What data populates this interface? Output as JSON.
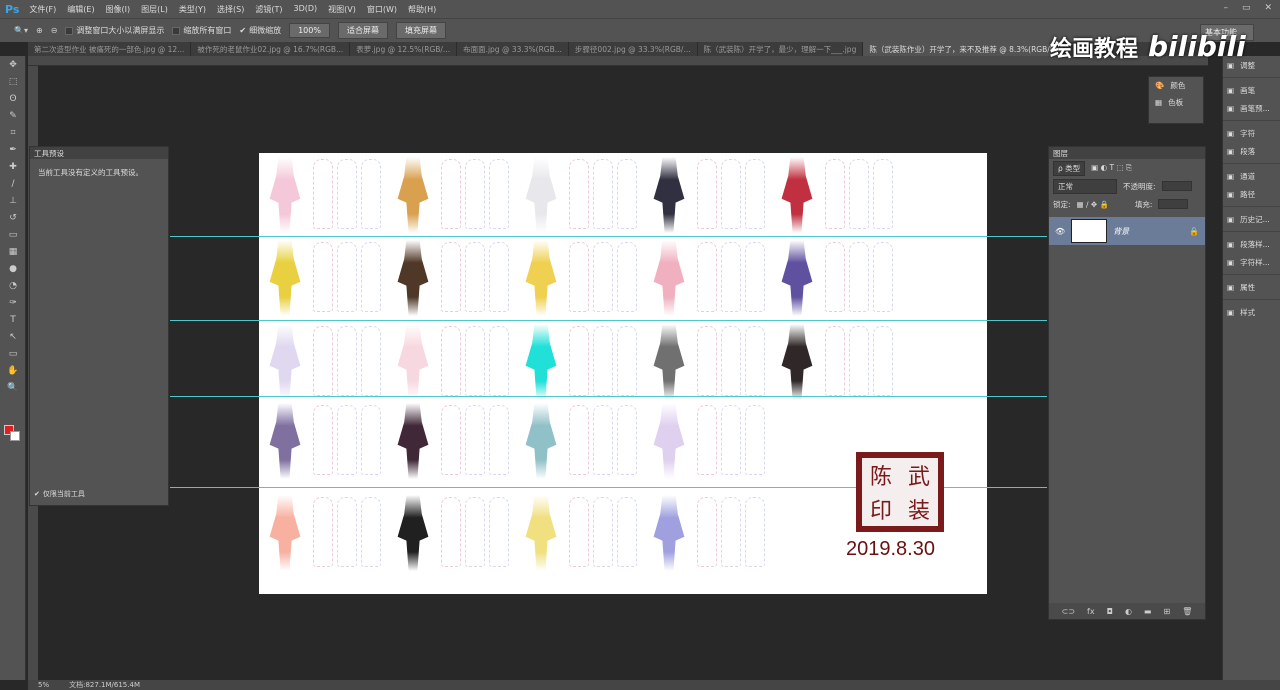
{
  "app": {
    "logo": "Ps"
  },
  "menu": [
    "文件(F)",
    "编辑(E)",
    "图像(I)",
    "图层(L)",
    "类型(Y)",
    "选择(S)",
    "滤镜(T)",
    "3D(D)",
    "视图(V)",
    "窗口(W)",
    "帮助(H)"
  ],
  "window_controls": [
    "–",
    "▭",
    "✕"
  ],
  "options": {
    "resize_windows": "调整窗口大小以满屏显示",
    "zoom_all": "缩放所有窗口",
    "scrubby_zoom": "细微缩放",
    "zoom_pct": "100%",
    "fit_screen": "适合屏幕",
    "fill_screen": "填充屏幕",
    "workspace": "基本功能"
  },
  "tabs": [
    "第二次造型作业 被痛死的一部色.jpg @ 12...",
    "被作死的老鼠作业02.jpg @ 16.7%(RGB...",
    "表萝.jpg @ 12.5%(RGB/...",
    "布面面.jpg @ 33.3%(RGB...",
    "步骤径002.jpg @ 33.3%(RGB/...",
    "陈（武装陈）开学了，最少，理解一下___.jpg",
    "陈（武装陈作业）开学了，来不及推荐 @ 8.3%(RGB/8)"
  ],
  "presets_panel": {
    "title": "工具预设",
    "message": "当前工具没有定义的工具预设。",
    "current_only": "仅限当前工具"
  },
  "canvas": {
    "stamp": [
      "陈",
      "武",
      "印",
      "装"
    ],
    "date": "2019.8.30",
    "thumbs": [
      [
        "#f4c8d8",
        "#d9a050",
        "#e8e8ec",
        "#303040",
        "#c03040"
      ],
      [
        "#e8d040",
        "#503828",
        "#f0d050",
        "#f0b0c0",
        "#6050a0"
      ],
      [
        "#e0d8f0",
        "#f8d8e0",
        "#20e0d8",
        "#707070",
        "#302828"
      ],
      [
        "#8070a0",
        "#402838",
        "#90c0c8",
        "#e0d0f0",
        ""
      ],
      [
        "#f8b0a0",
        "#202020",
        "#f0e080",
        "#a0a0e0",
        ""
      ]
    ]
  },
  "color_panel": {
    "items": [
      "颜色",
      "色板"
    ]
  },
  "layers_panel": {
    "title": "图层",
    "filter": "ρ 类型",
    "blend": "正常",
    "opacity_label": "不透明度:",
    "lock_label": "锁定:",
    "fill_label": "填充:",
    "layer_name": "背景"
  },
  "dock": [
    "调整",
    "画笔",
    "画笔预...",
    "字符",
    "段落",
    "通道",
    "路径",
    "历史记...",
    "段落样...",
    "字符样...",
    "属性",
    "样式"
  ],
  "status": {
    "zoom": "5%",
    "doc": "文档:827.1M/615.4M"
  },
  "watermark": {
    "text": "绘画教程",
    "brand": "bilibili"
  }
}
